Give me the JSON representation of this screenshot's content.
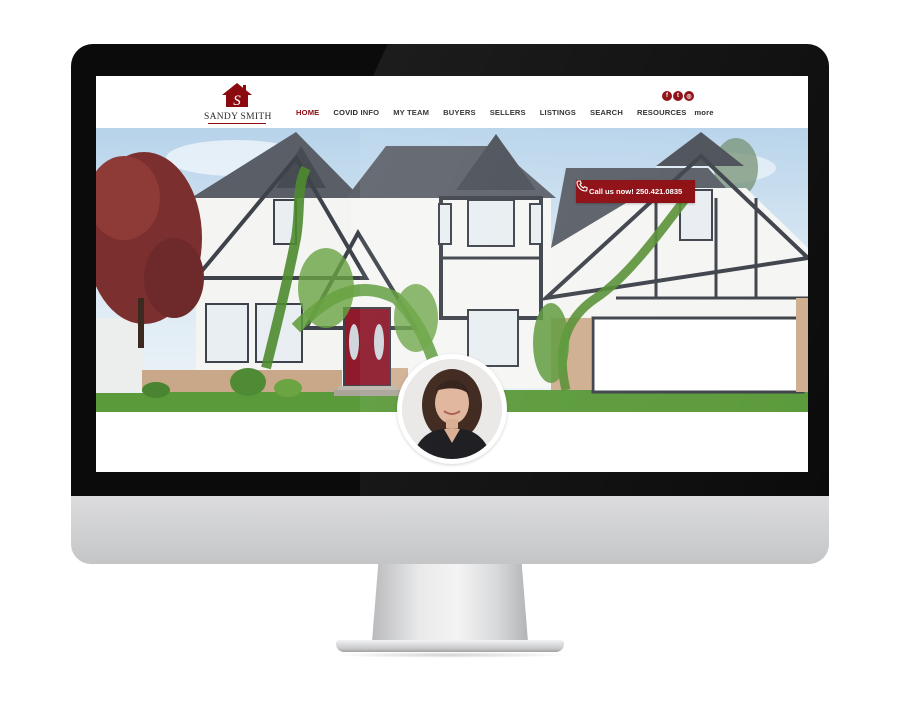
{
  "brand": {
    "name": "SANDY SMITH",
    "monogram": "S",
    "color": "#8b0a0f"
  },
  "social": [
    {
      "icon": "facebook-icon",
      "glyph": "f"
    },
    {
      "icon": "twitter-icon",
      "glyph": "t"
    },
    {
      "icon": "instagram-icon",
      "glyph": "◎"
    }
  ],
  "nav": {
    "items": [
      {
        "label": "HOME",
        "active": true
      },
      {
        "label": "COVID INFO"
      },
      {
        "label": "MY TEAM"
      },
      {
        "label": "BUYERS"
      },
      {
        "label": "SELLERS"
      },
      {
        "label": "LISTINGS"
      },
      {
        "label": "SEARCH"
      },
      {
        "label": "RESOURCES"
      },
      {
        "label": "more"
      }
    ]
  },
  "hero": {
    "call_label": "Call us now! 250.421.0835",
    "call_icon": "phone-icon"
  }
}
